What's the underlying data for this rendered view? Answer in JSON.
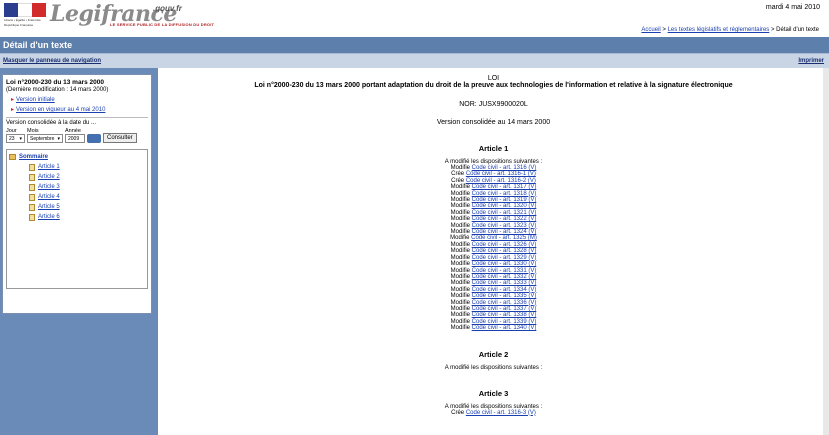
{
  "header": {
    "site_name": "Legifrance",
    "site_suffix": ".gouv.fr",
    "tagline": "LE SERVICE PUBLIC DE LA DIFFUSION DU DROIT",
    "flag_motto": "Liberté • Égalité • Fraternité",
    "flag_republic": "République Française",
    "date": "mardi 4 mai 2010",
    "breadcrumb": {
      "home": "Accueil",
      "sep1": " > ",
      "section": "Les textes législatifs et réglementaires",
      "sep2": " > ",
      "current": "Détail d'un texte"
    }
  },
  "titlebar": {
    "title": "Détail d'un texte"
  },
  "subbar": {
    "hide_nav": "Masquer le panneau de navigation",
    "print": "Imprimer"
  },
  "sidebar": {
    "law_title": "Loi n°2000-230 du 13 mars 2000",
    "last_modified": "(Dernière modification : 14 mars 2000)",
    "version_initial": "Version initiale",
    "version_current": "Version en vigueur au 4 mai 2010",
    "consolidated_at": "Version consolidée à la date du ...",
    "day_label": "Jour",
    "month_label": "Mois",
    "year_label": "Année",
    "day_value": "23",
    "month_value": "Septembre",
    "year_value": "2009",
    "consult_button": "Consulter",
    "tree": {
      "root": "Sommaire",
      "items": [
        "Article 1",
        "Article 2",
        "Article 3",
        "Article 4",
        "Article 5",
        "Article 6"
      ]
    }
  },
  "main": {
    "loi_label": "LOI",
    "title": "Loi n°2000-230 du 13 mars 2000 portant adaptation du droit de la preuve aux technologies de l'information et relative à la signature électronique",
    "nor": "NOR: JUSX9900020L",
    "version": "Version consolidée au 14 mars 2000",
    "articles": [
      {
        "heading": "Article 1",
        "intro": "A modifié les dispositions suivantes :",
        "lines": [
          {
            "action": "Modifie",
            "link": "Code civil - art. 1316 (V)"
          },
          {
            "action": "Crée",
            "link": "Code civil - art. 1316-1 (V)"
          },
          {
            "action": "Crée",
            "link": "Code civil - art. 1316-2 (V)"
          },
          {
            "action": "Modifie",
            "link": "Code civil - art. 1317 (V)"
          },
          {
            "action": "Modifie",
            "link": "Code civil - art. 1318 (V)"
          },
          {
            "action": "Modifie",
            "link": "Code civil - art. 1319 (V)"
          },
          {
            "action": "Modifie",
            "link": "Code civil - art. 1320 (V)"
          },
          {
            "action": "Modifie",
            "link": "Code civil - art. 1321 (V)"
          },
          {
            "action": "Modifie",
            "link": "Code civil - art. 1322 (V)"
          },
          {
            "action": "Modifie",
            "link": "Code civil - art. 1323 (V)"
          },
          {
            "action": "Modifie",
            "link": "Code civil - art. 1324 (V)"
          },
          {
            "action": "Modifie",
            "link": "Code civil - art. 1325 (M)"
          },
          {
            "action": "Modifie",
            "link": "Code civil - art. 1326 (V)"
          },
          {
            "action": "Modifie",
            "link": "Code civil - art. 1328 (V)"
          },
          {
            "action": "Modifie",
            "link": "Code civil - art. 1329 (V)"
          },
          {
            "action": "Modifie",
            "link": "Code civil - art. 1330 (V)"
          },
          {
            "action": "Modifie",
            "link": "Code civil - art. 1331 (V)"
          },
          {
            "action": "Modifie",
            "link": "Code civil - art. 1332 (V)"
          },
          {
            "action": "Modifie",
            "link": "Code civil - art. 1333 (V)"
          },
          {
            "action": "Modifie",
            "link": "Code civil - art. 1334 (V)"
          },
          {
            "action": "Modifie",
            "link": "Code civil - art. 1335 (V)"
          },
          {
            "action": "Modifie",
            "link": "Code civil - art. 1336 (V)"
          },
          {
            "action": "Modifie",
            "link": "Code civil - art. 1337 (V)"
          },
          {
            "action": "Modifie",
            "link": "Code civil - art. 1338 (V)"
          },
          {
            "action": "Modifie",
            "link": "Code civil - art. 1339 (V)"
          },
          {
            "action": "Modifie",
            "link": "Code civil - art. 1340 (V)"
          }
        ]
      },
      {
        "heading": "Article 2",
        "intro": "A modifié les dispositions suivantes :",
        "lines": []
      },
      {
        "heading": "Article 3",
        "intro": "A modifié les dispositions suivantes :",
        "lines": [
          {
            "action": "Crée",
            "link": "Code civil - art. 1316-3 (V)"
          }
        ]
      }
    ]
  }
}
